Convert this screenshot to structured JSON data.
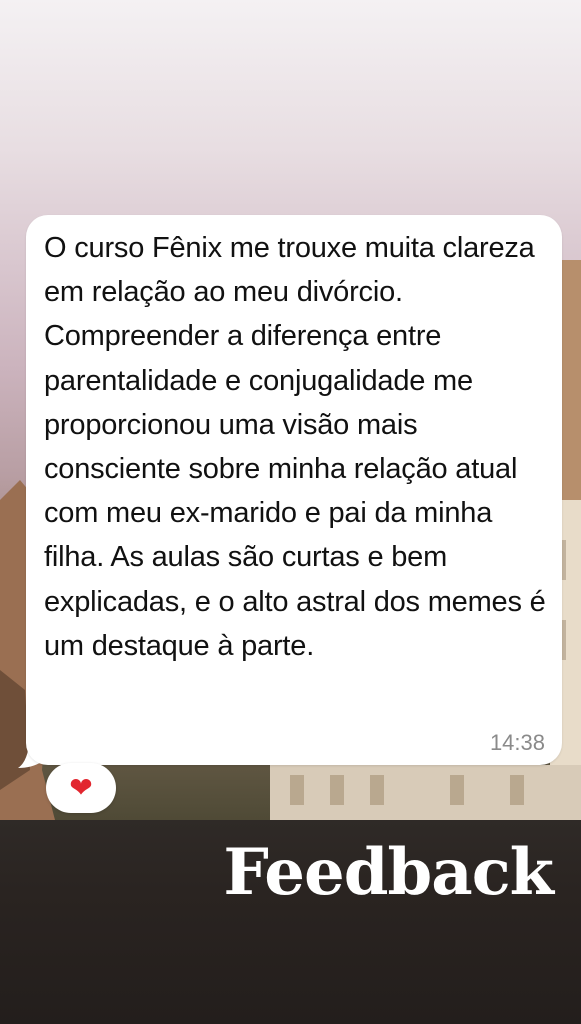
{
  "message": {
    "text": "O curso Fênix me trouxe muita clareza em relação ao meu divórcio. Compreender a diferença entre parentalidade e conjugalidade me proporcionou uma visão mais consciente sobre minha relação atual com meu ex-marido e pai da minha filha. As aulas são curtas e bem explicadas, e o alto astral dos memes é um destaque à parte.",
    "time": "14:38",
    "reaction": "❤️"
  },
  "overlay": {
    "title": "Feedback"
  },
  "colors": {
    "bubble": "#ffffff",
    "heart": "#e2262f",
    "title": "#ffffff"
  },
  "icons": {
    "reaction": "heart-icon"
  }
}
